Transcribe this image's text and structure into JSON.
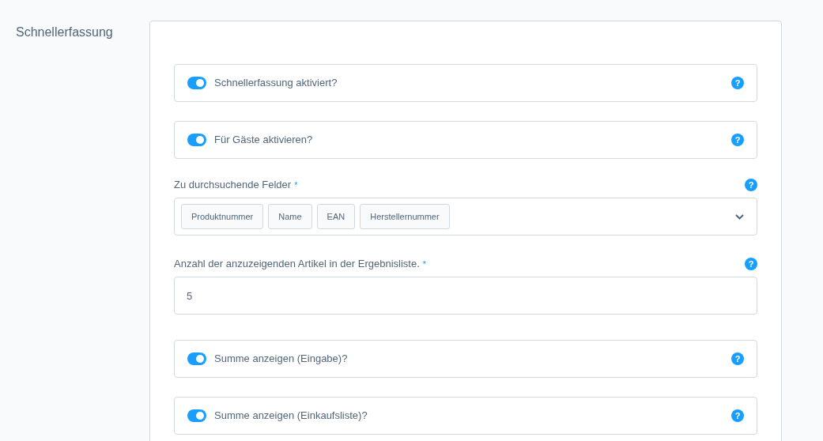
{
  "section_title": "Schnellerfassung",
  "fields": [
    {
      "kind": "toggle",
      "label": "Schnellerfassung aktiviert?",
      "on": true,
      "help": "?"
    },
    {
      "kind": "toggle",
      "label": "Für Gäste aktivieren?",
      "on": true,
      "help": "?"
    },
    {
      "kind": "multiselect",
      "label": "Zu durchsuchende Felder",
      "required_mark": "*",
      "help": "?",
      "tags": [
        "Produktnummer",
        "Name",
        "EAN",
        "Herstellernummer"
      ]
    },
    {
      "kind": "number",
      "label": "Anzahl der anzuzeigenden Artikel in der Ergebnisliste.",
      "required_mark": "*",
      "help": "?",
      "value": "5"
    },
    {
      "kind": "toggle",
      "label": "Summe anzeigen (Eingabe)?",
      "on": true,
      "help": "?"
    },
    {
      "kind": "toggle",
      "label": "Summe anzeigen (Einkaufsliste)?",
      "on": true,
      "help": "?"
    }
  ]
}
